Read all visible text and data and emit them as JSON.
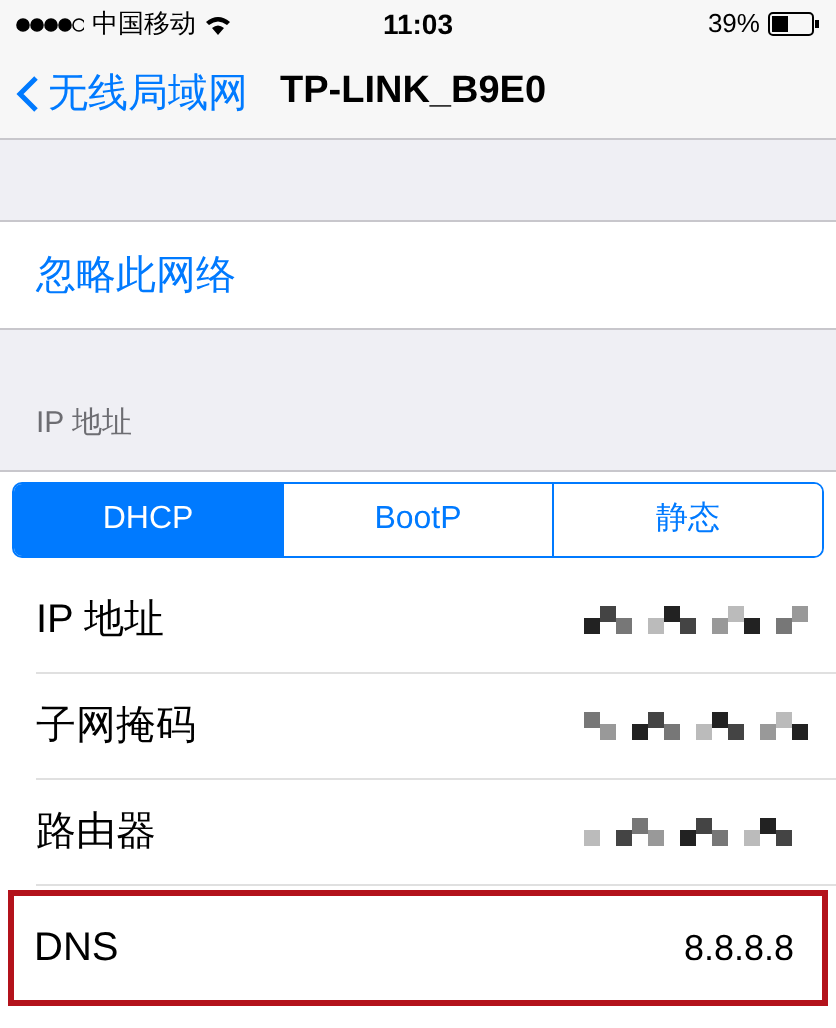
{
  "status_bar": {
    "carrier": "中国移动",
    "time": "11:03",
    "battery": "39%"
  },
  "nav": {
    "back": "无线局域网",
    "title": "TP-LINK_B9E0"
  },
  "forget": {
    "label": "忽略此网络"
  },
  "section_header": "IP 地址",
  "segments": [
    {
      "label": "DHCP",
      "selected": true
    },
    {
      "label": "BootP",
      "selected": false
    },
    {
      "label": "静态",
      "selected": false
    }
  ],
  "rows": [
    {
      "kind": "redacted",
      "label": "IP 地址",
      "highlighted": false
    },
    {
      "kind": "redacted",
      "label": "子网掩码",
      "highlighted": false
    },
    {
      "kind": "redacted",
      "label": "路由器",
      "highlighted": false
    },
    {
      "kind": "value",
      "label": "DNS",
      "value": "8.8.8.8",
      "highlighted": true
    }
  ]
}
